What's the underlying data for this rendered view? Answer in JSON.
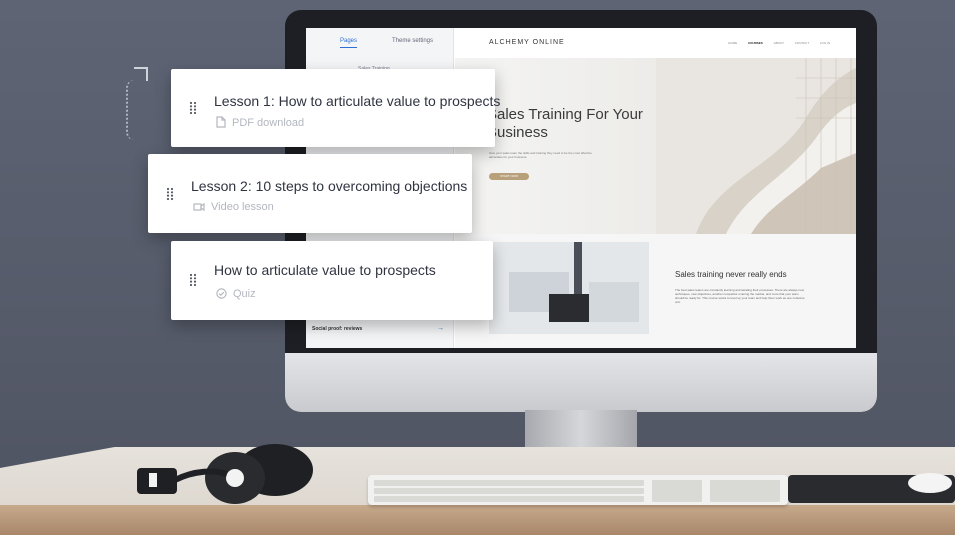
{
  "editor": {
    "tabs": [
      {
        "label": "Pages",
        "active": true
      },
      {
        "label": "Theme settings",
        "active": false
      }
    ],
    "subheading": "Sales Training",
    "last_item": {
      "label": "Social proof: reviews"
    }
  },
  "website": {
    "brand": "ALCHEMY ONLINE",
    "nav": [
      "HOME",
      "COURSES",
      "ABOUT",
      "CONTACT",
      "LOG IN"
    ],
    "hero_title": "Sales Training For Your Business",
    "hero_text": "Give your sales team the skills and training they need to be the most effective advocates for your business.",
    "hero_button": "START NOW",
    "section_title": "Sales training never really ends",
    "section_text": "The best sales teams are constantly learning and iterating their processes. There are always new techniques, new objectives, another competitor entering the market, and more that your team should be ready for. This course works to level up your team and help them work as one cohesive unit."
  },
  "lesson_cards": [
    {
      "title": "Lesson 1: How to articulate value to prospects",
      "type": "PDF download",
      "icon": "document-icon"
    },
    {
      "title": "Lesson 2: 10 steps to overcoming objections",
      "type": "Video lesson",
      "icon": "video-icon"
    },
    {
      "title": "How to articulate value to prospects",
      "type": "Quiz",
      "icon": "check-circle-icon"
    }
  ],
  "colors": {
    "background": "#5b6070",
    "accent": "#2e6fd6",
    "button": "#b7a07a"
  }
}
